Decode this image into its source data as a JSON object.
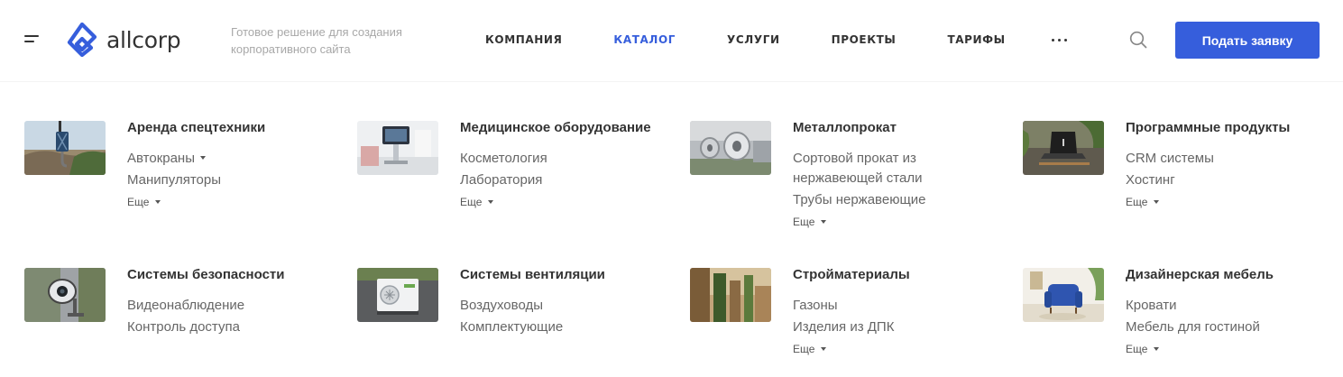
{
  "header": {
    "logo_text": "allcorp",
    "slogan": "Готовое решение для создания корпоративного сайта",
    "nav": [
      {
        "label": "КОМПАНИЯ",
        "active": false
      },
      {
        "label": "КАТАЛОГ",
        "active": true
      },
      {
        "label": "УСЛУГИ",
        "active": false
      },
      {
        "label": "ПРОЕКТЫ",
        "active": false
      },
      {
        "label": "ТАРИФЫ",
        "active": false
      }
    ],
    "cta_label": "Подать заявку",
    "accent_color": "#365edc"
  },
  "catalog": [
    {
      "title": "Аренда спецтехники",
      "image": "crane-image",
      "subs": [
        {
          "label": "Автокраны",
          "has_children": true
        },
        {
          "label": "Манипуляторы",
          "has_children": false
        }
      ],
      "more": "Еще"
    },
    {
      "title": "Медицинское оборудование",
      "image": "medical-equipment-image",
      "subs": [
        {
          "label": "Косметология",
          "has_children": false
        },
        {
          "label": "Лаборатория",
          "has_children": false
        }
      ],
      "more": "Еще"
    },
    {
      "title": "Металлопрокат",
      "image": "metal-rolls-image",
      "subs": [
        {
          "label": "Сортовой прокат из нержавеющей стали",
          "has_children": false
        },
        {
          "label": "Трубы нержавеющие",
          "has_children": false
        }
      ],
      "more": "Еще"
    },
    {
      "title": "Программные продукты",
      "image": "laptop-image",
      "subs": [
        {
          "label": "CRM системы",
          "has_children": false
        },
        {
          "label": "Хостинг",
          "has_children": false
        }
      ],
      "more": "Еще"
    },
    {
      "title": "Системы безопасности",
      "image": "security-camera-image",
      "subs": [
        {
          "label": "Видеонаблюдение",
          "has_children": false
        },
        {
          "label": "Контроль доступа",
          "has_children": false
        }
      ],
      "more": ""
    },
    {
      "title": "Системы вентиляции",
      "image": "air-conditioner-image",
      "subs": [
        {
          "label": "Воздуховоды",
          "has_children": false
        },
        {
          "label": "Комплектующие",
          "has_children": false
        }
      ],
      "more": ""
    },
    {
      "title": "Стройматериалы",
      "image": "building-materials-image",
      "subs": [
        {
          "label": "Газоны",
          "has_children": false
        },
        {
          "label": "Изделия из ДПК",
          "has_children": false
        }
      ],
      "more": "Еще"
    },
    {
      "title": "Дизайнерская мебель",
      "image": "armchair-image",
      "subs": [
        {
          "label": "Кровати",
          "has_children": false
        },
        {
          "label": "Мебель для гостиной",
          "has_children": false
        }
      ],
      "more": "Еще"
    }
  ]
}
